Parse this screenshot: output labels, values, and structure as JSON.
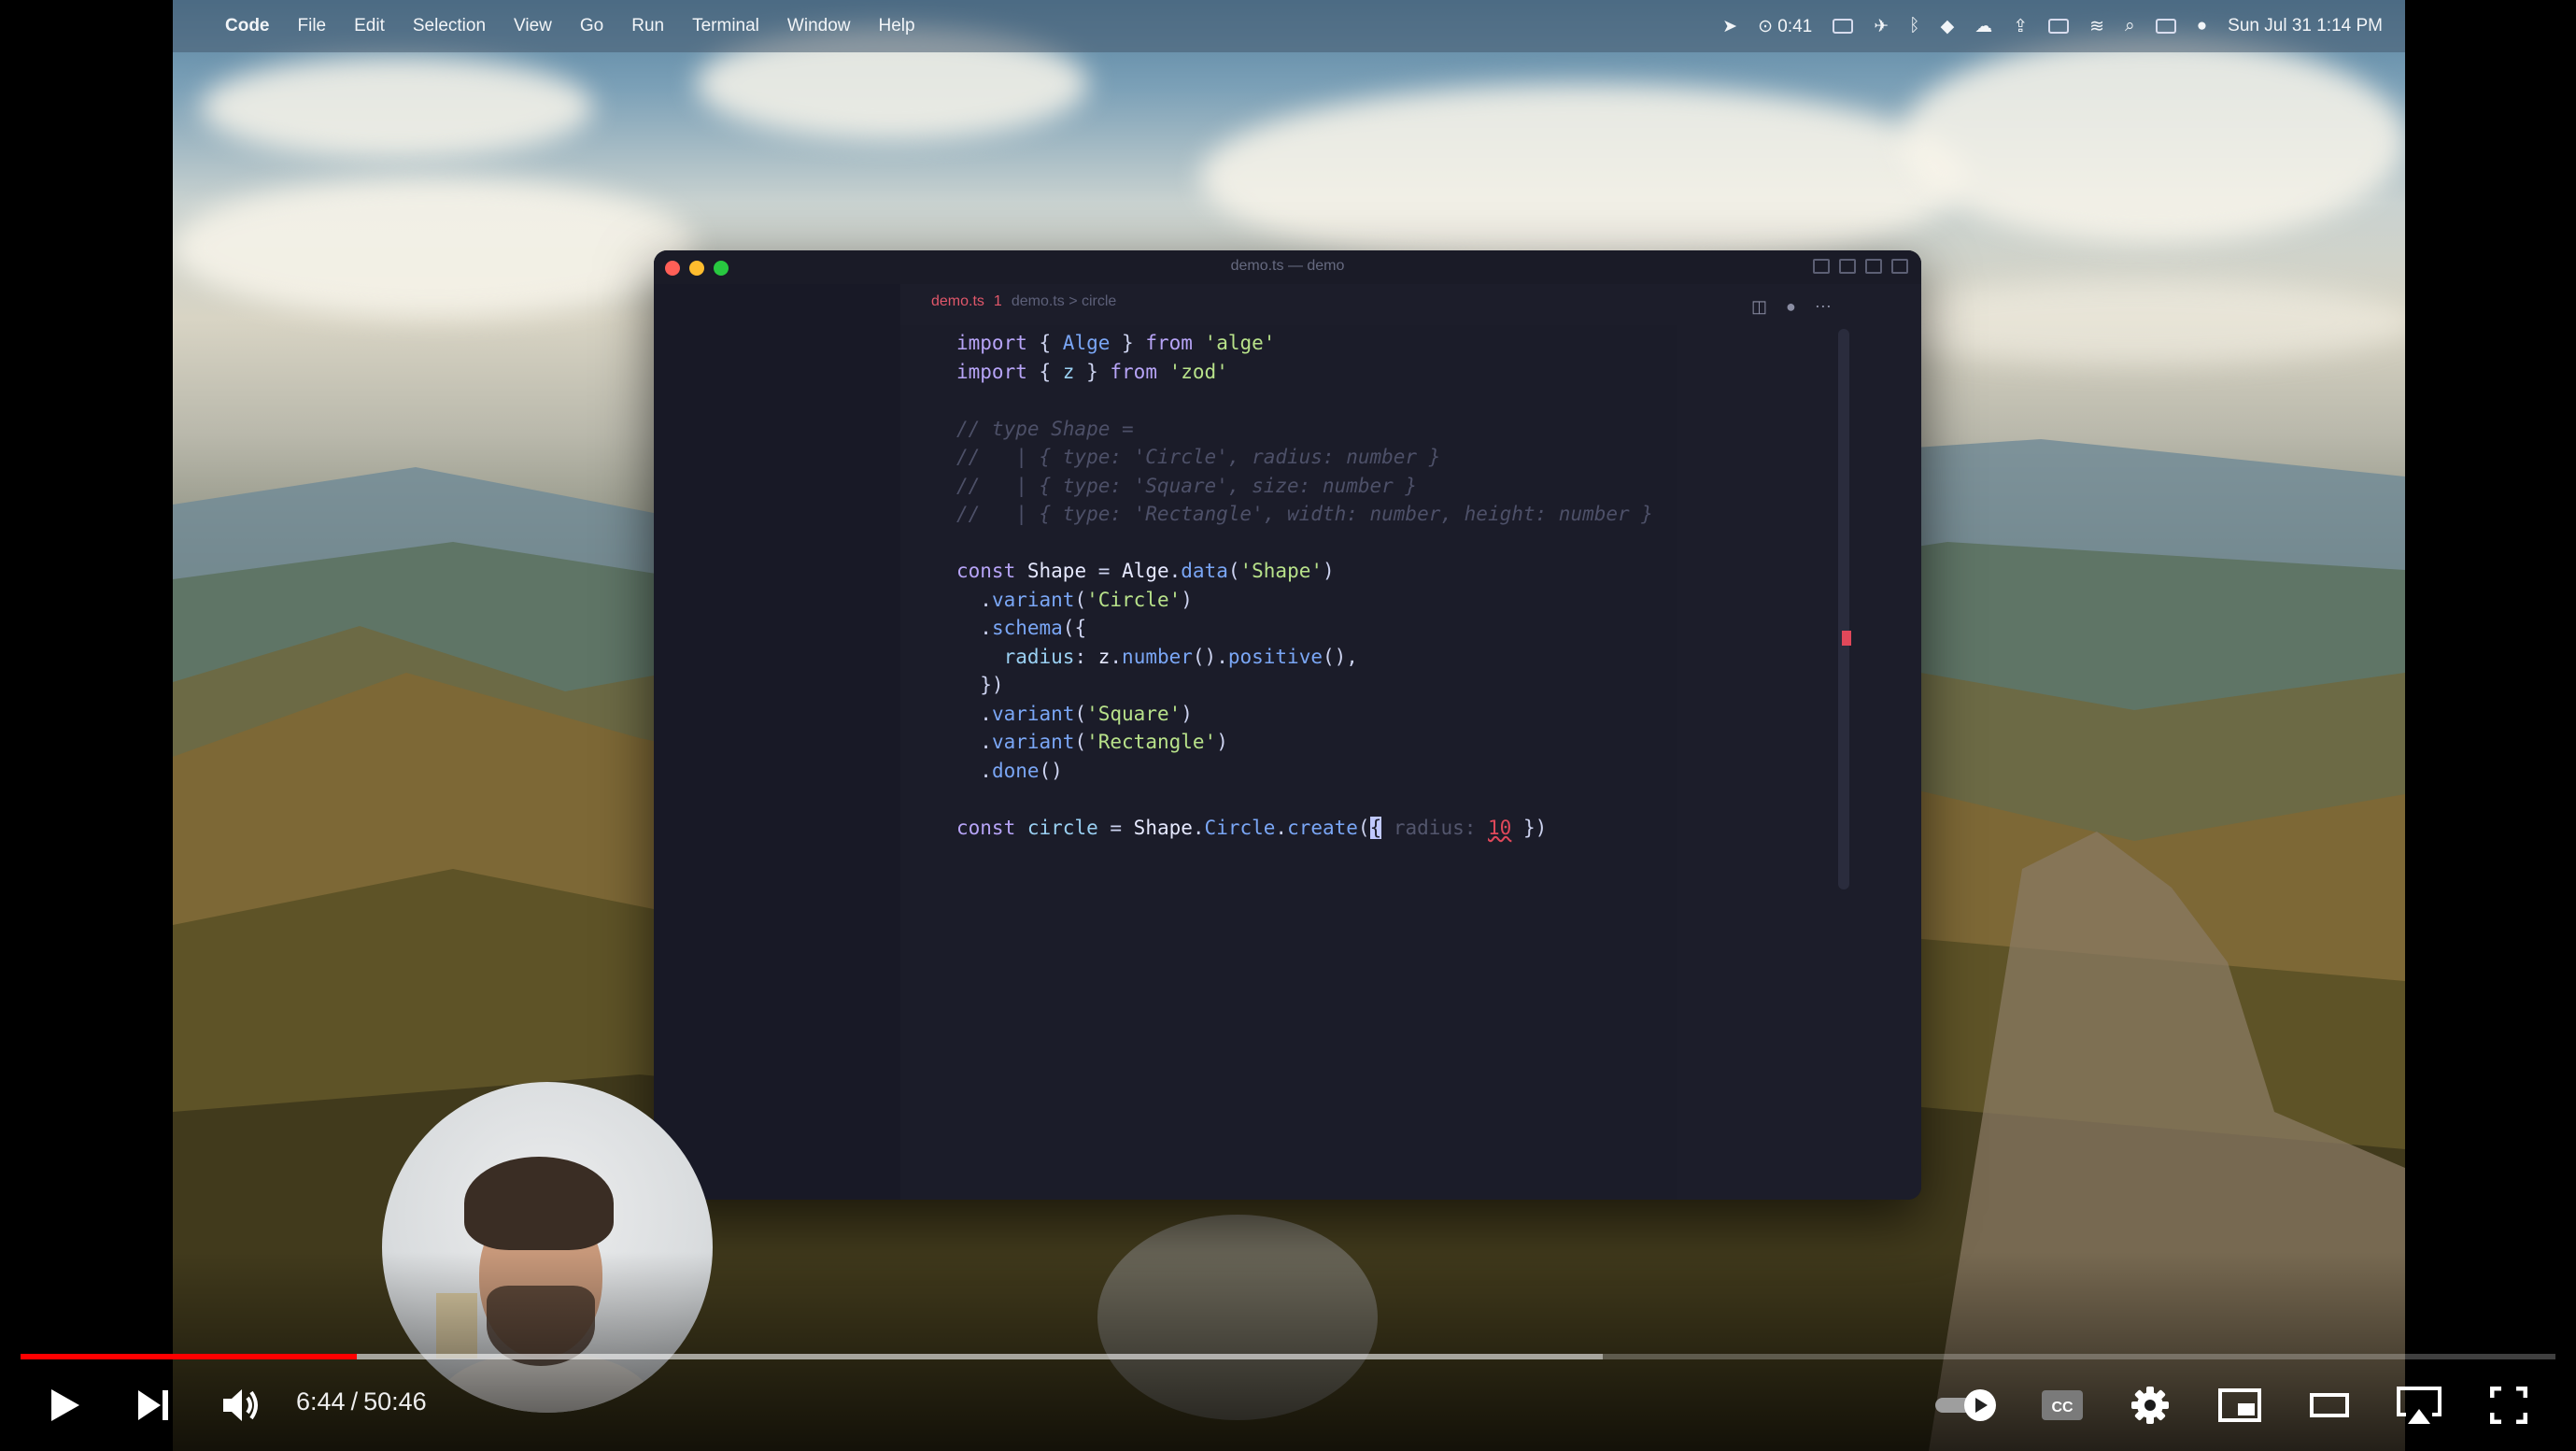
{
  "menubar": {
    "app_name": "Code",
    "menus": [
      "File",
      "Edit",
      "Selection",
      "View",
      "Go",
      "Run",
      "Terminal",
      "Window",
      "Help"
    ],
    "status_time_widget": "0:41",
    "datetime": "Sun Jul 31  1:14 PM"
  },
  "editor": {
    "window_title": "demo.ts — demo",
    "tab": {
      "name": "demo.ts",
      "badge": "1",
      "breadcrumb": "demo.ts > circle"
    }
  },
  "code_lines": [
    "import { Alge } from 'alge'",
    "import { z } from 'zod'",
    "",
    "// type Shape =",
    "//   | { type: 'Circle', radius: number }",
    "//   | { type: 'Square', size: number }",
    "//   | { type: 'Rectangle', width: number, height: number }",
    "",
    "const Shape = Alge.data('Shape')",
    "  .variant('Circle')",
    "  .schema({",
    "    radius: z.number().positive(),",
    "  })",
    "  .variant('Square')",
    "  .variant('Rectangle')",
    "  .done()",
    "",
    "const circle = Shape.Circle.create({ radius: 10 })"
  ],
  "player": {
    "current_time": "6:44",
    "duration": "50:46",
    "progress_fraction": 0.1327,
    "buffered_fraction": 0.624,
    "autoplay_on": true,
    "colors": {
      "played": "#ff0000",
      "accent": "#ffffff"
    }
  },
  "icons": {
    "play": "play-icon",
    "next": "next-icon",
    "volume": "volume-icon",
    "autoplay": "autoplay-toggle-icon",
    "captions": "captions-icon",
    "settings": "gear-icon",
    "miniplayer": "miniplayer-icon",
    "theater": "theater-mode-icon",
    "airplay": "airplay-icon",
    "fullscreen": "fullscreen-icon"
  }
}
